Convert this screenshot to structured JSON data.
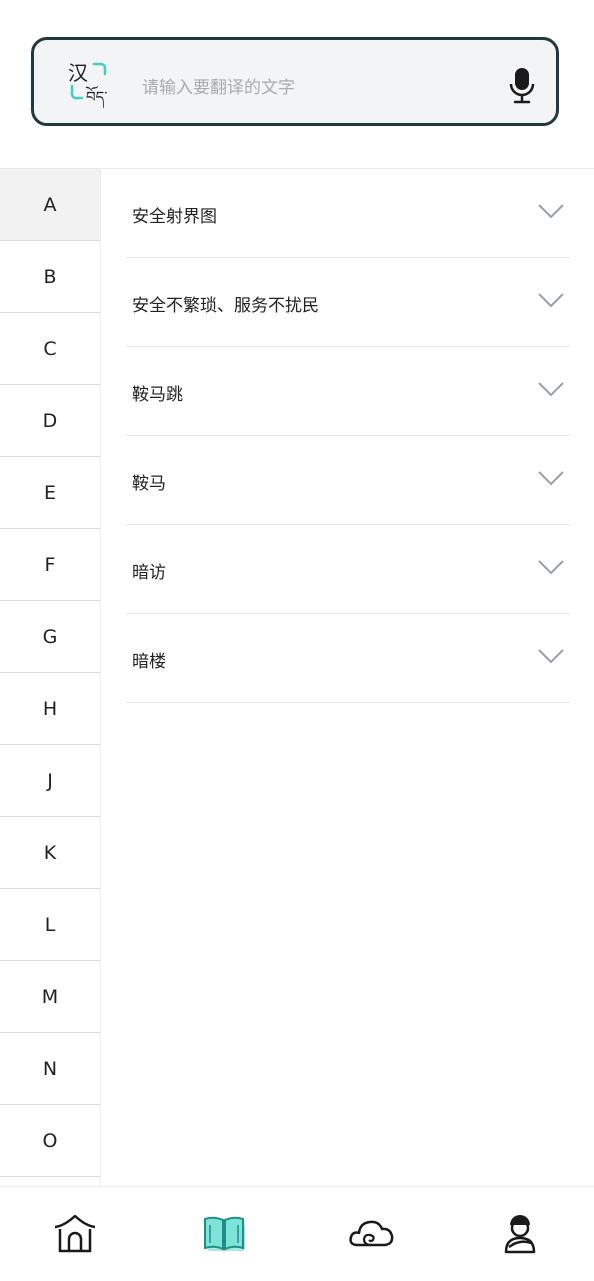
{
  "search": {
    "placeholder": "请输入要翻译的文字",
    "logo_char": "汉",
    "logo_tibetan": "བོད་"
  },
  "index": {
    "active": "A",
    "letters": [
      "A",
      "B",
      "C",
      "D",
      "E",
      "F",
      "G",
      "H",
      "J",
      "K",
      "L",
      "M",
      "N",
      "O"
    ]
  },
  "entries": [
    {
      "label": "安全射界图"
    },
    {
      "label": "安全不繁琐、服务不扰民"
    },
    {
      "label": "鞍马跳"
    },
    {
      "label": "鞍马"
    },
    {
      "label": "暗访"
    },
    {
      "label": "暗楼"
    }
  ],
  "tabs": [
    {
      "icon": "home-icon",
      "active": false
    },
    {
      "icon": "book-icon",
      "active": true
    },
    {
      "icon": "cloud-icon",
      "active": false
    },
    {
      "icon": "person-icon",
      "active": false
    }
  ],
  "colors": {
    "accent": "#3ecfc0",
    "border": "#1f3b40",
    "chevron": "#9aa0a6"
  }
}
